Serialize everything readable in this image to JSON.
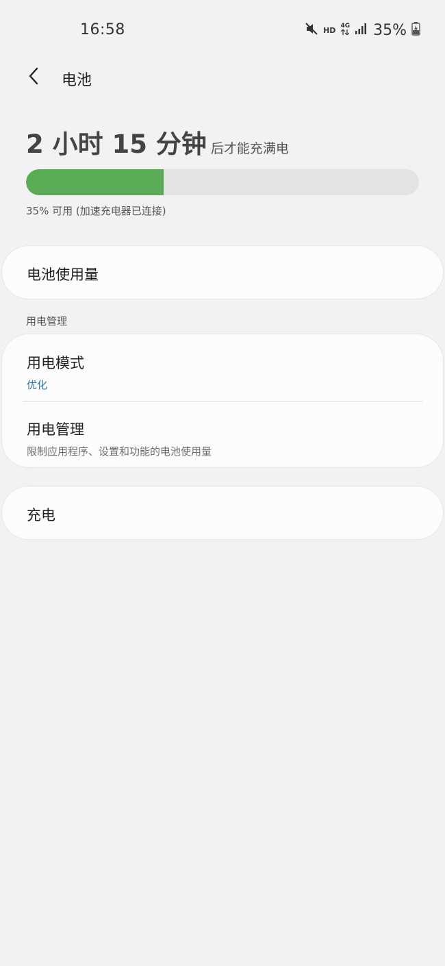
{
  "status_bar": {
    "time": "16:58",
    "hd_label": "HD",
    "network_label": "4G",
    "battery_percent": "35%",
    "icons": [
      "mute-icon",
      "signal-icon",
      "battery-charging-icon"
    ]
  },
  "header": {
    "title": "电池"
  },
  "charge": {
    "time_remaining": "2 小时 15 分钟",
    "suffix": "后才能充满电",
    "level_fraction": 0.35,
    "status_text": "35% 可用 (加速充电器已连接)"
  },
  "battery_usage": {
    "label": "电池使用量"
  },
  "power_management_section": {
    "header": "用电管理",
    "items": [
      {
        "title": "用电模式",
        "subtitle": "优化"
      },
      {
        "title": "用电管理",
        "subtitle": "限制应用程序、设置和功能的电池使用量"
      }
    ]
  },
  "charging": {
    "label": "充电"
  },
  "colors": {
    "accent_green": "#5aab55",
    "link_blue": "#2a79a6",
    "background": "#f2f2f2",
    "card": "#fcfcfc"
  }
}
